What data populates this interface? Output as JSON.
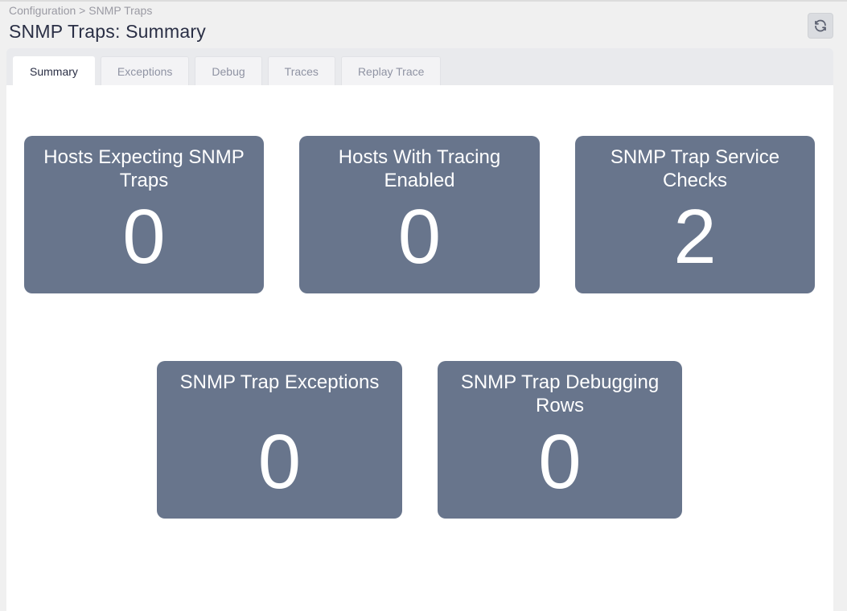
{
  "breadcrumb": "Configuration > SNMP Traps",
  "title": "SNMP Traps: Summary",
  "refresh_icon": "refresh-icon",
  "tabs": [
    {
      "label": "Summary",
      "active": true
    },
    {
      "label": "Exceptions",
      "active": false
    },
    {
      "label": "Debug",
      "active": false
    },
    {
      "label": "Traces",
      "active": false
    },
    {
      "label": "Replay Trace",
      "active": false
    }
  ],
  "cards": [
    {
      "title": "Hosts Expecting SNMP Traps",
      "value": "0"
    },
    {
      "title": "Hosts With Tracing Enabled",
      "value": "0"
    },
    {
      "title": "SNMP Trap Service Checks",
      "value": "2"
    },
    {
      "title": "SNMP Trap Exceptions",
      "value": "0"
    },
    {
      "title": "SNMP Trap Debugging Rows",
      "value": "0"
    }
  ],
  "colors": {
    "card": "#68758c",
    "title": "#2a2f45"
  }
}
